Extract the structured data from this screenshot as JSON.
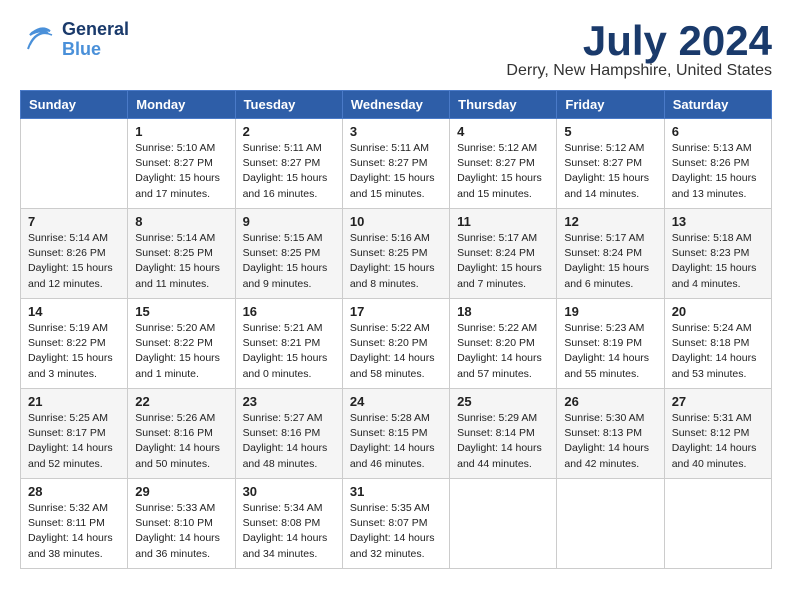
{
  "header": {
    "logo_general": "General",
    "logo_blue": "Blue",
    "month": "July 2024",
    "location": "Derry, New Hampshire, United States"
  },
  "weekdays": [
    "Sunday",
    "Monday",
    "Tuesday",
    "Wednesday",
    "Thursday",
    "Friday",
    "Saturday"
  ],
  "weeks": [
    [
      {
        "day": "",
        "info": ""
      },
      {
        "day": "1",
        "info": "Sunrise: 5:10 AM\nSunset: 8:27 PM\nDaylight: 15 hours\nand 17 minutes."
      },
      {
        "day": "2",
        "info": "Sunrise: 5:11 AM\nSunset: 8:27 PM\nDaylight: 15 hours\nand 16 minutes."
      },
      {
        "day": "3",
        "info": "Sunrise: 5:11 AM\nSunset: 8:27 PM\nDaylight: 15 hours\nand 15 minutes."
      },
      {
        "day": "4",
        "info": "Sunrise: 5:12 AM\nSunset: 8:27 PM\nDaylight: 15 hours\nand 15 minutes."
      },
      {
        "day": "5",
        "info": "Sunrise: 5:12 AM\nSunset: 8:27 PM\nDaylight: 15 hours\nand 14 minutes."
      },
      {
        "day": "6",
        "info": "Sunrise: 5:13 AM\nSunset: 8:26 PM\nDaylight: 15 hours\nand 13 minutes."
      }
    ],
    [
      {
        "day": "7",
        "info": "Sunrise: 5:14 AM\nSunset: 8:26 PM\nDaylight: 15 hours\nand 12 minutes."
      },
      {
        "day": "8",
        "info": "Sunrise: 5:14 AM\nSunset: 8:25 PM\nDaylight: 15 hours\nand 11 minutes."
      },
      {
        "day": "9",
        "info": "Sunrise: 5:15 AM\nSunset: 8:25 PM\nDaylight: 15 hours\nand 9 minutes."
      },
      {
        "day": "10",
        "info": "Sunrise: 5:16 AM\nSunset: 8:25 PM\nDaylight: 15 hours\nand 8 minutes."
      },
      {
        "day": "11",
        "info": "Sunrise: 5:17 AM\nSunset: 8:24 PM\nDaylight: 15 hours\nand 7 minutes."
      },
      {
        "day": "12",
        "info": "Sunrise: 5:17 AM\nSunset: 8:24 PM\nDaylight: 15 hours\nand 6 minutes."
      },
      {
        "day": "13",
        "info": "Sunrise: 5:18 AM\nSunset: 8:23 PM\nDaylight: 15 hours\nand 4 minutes."
      }
    ],
    [
      {
        "day": "14",
        "info": "Sunrise: 5:19 AM\nSunset: 8:22 PM\nDaylight: 15 hours\nand 3 minutes."
      },
      {
        "day": "15",
        "info": "Sunrise: 5:20 AM\nSunset: 8:22 PM\nDaylight: 15 hours\nand 1 minute."
      },
      {
        "day": "16",
        "info": "Sunrise: 5:21 AM\nSunset: 8:21 PM\nDaylight: 15 hours\nand 0 minutes."
      },
      {
        "day": "17",
        "info": "Sunrise: 5:22 AM\nSunset: 8:20 PM\nDaylight: 14 hours\nand 58 minutes."
      },
      {
        "day": "18",
        "info": "Sunrise: 5:22 AM\nSunset: 8:20 PM\nDaylight: 14 hours\nand 57 minutes."
      },
      {
        "day": "19",
        "info": "Sunrise: 5:23 AM\nSunset: 8:19 PM\nDaylight: 14 hours\nand 55 minutes."
      },
      {
        "day": "20",
        "info": "Sunrise: 5:24 AM\nSunset: 8:18 PM\nDaylight: 14 hours\nand 53 minutes."
      }
    ],
    [
      {
        "day": "21",
        "info": "Sunrise: 5:25 AM\nSunset: 8:17 PM\nDaylight: 14 hours\nand 52 minutes."
      },
      {
        "day": "22",
        "info": "Sunrise: 5:26 AM\nSunset: 8:16 PM\nDaylight: 14 hours\nand 50 minutes."
      },
      {
        "day": "23",
        "info": "Sunrise: 5:27 AM\nSunset: 8:16 PM\nDaylight: 14 hours\nand 48 minutes."
      },
      {
        "day": "24",
        "info": "Sunrise: 5:28 AM\nSunset: 8:15 PM\nDaylight: 14 hours\nand 46 minutes."
      },
      {
        "day": "25",
        "info": "Sunrise: 5:29 AM\nSunset: 8:14 PM\nDaylight: 14 hours\nand 44 minutes."
      },
      {
        "day": "26",
        "info": "Sunrise: 5:30 AM\nSunset: 8:13 PM\nDaylight: 14 hours\nand 42 minutes."
      },
      {
        "day": "27",
        "info": "Sunrise: 5:31 AM\nSunset: 8:12 PM\nDaylight: 14 hours\nand 40 minutes."
      }
    ],
    [
      {
        "day": "28",
        "info": "Sunrise: 5:32 AM\nSunset: 8:11 PM\nDaylight: 14 hours\nand 38 minutes."
      },
      {
        "day": "29",
        "info": "Sunrise: 5:33 AM\nSunset: 8:10 PM\nDaylight: 14 hours\nand 36 minutes."
      },
      {
        "day": "30",
        "info": "Sunrise: 5:34 AM\nSunset: 8:08 PM\nDaylight: 14 hours\nand 34 minutes."
      },
      {
        "day": "31",
        "info": "Sunrise: 5:35 AM\nSunset: 8:07 PM\nDaylight: 14 hours\nand 32 minutes."
      },
      {
        "day": "",
        "info": ""
      },
      {
        "day": "",
        "info": ""
      },
      {
        "day": "",
        "info": ""
      }
    ]
  ]
}
